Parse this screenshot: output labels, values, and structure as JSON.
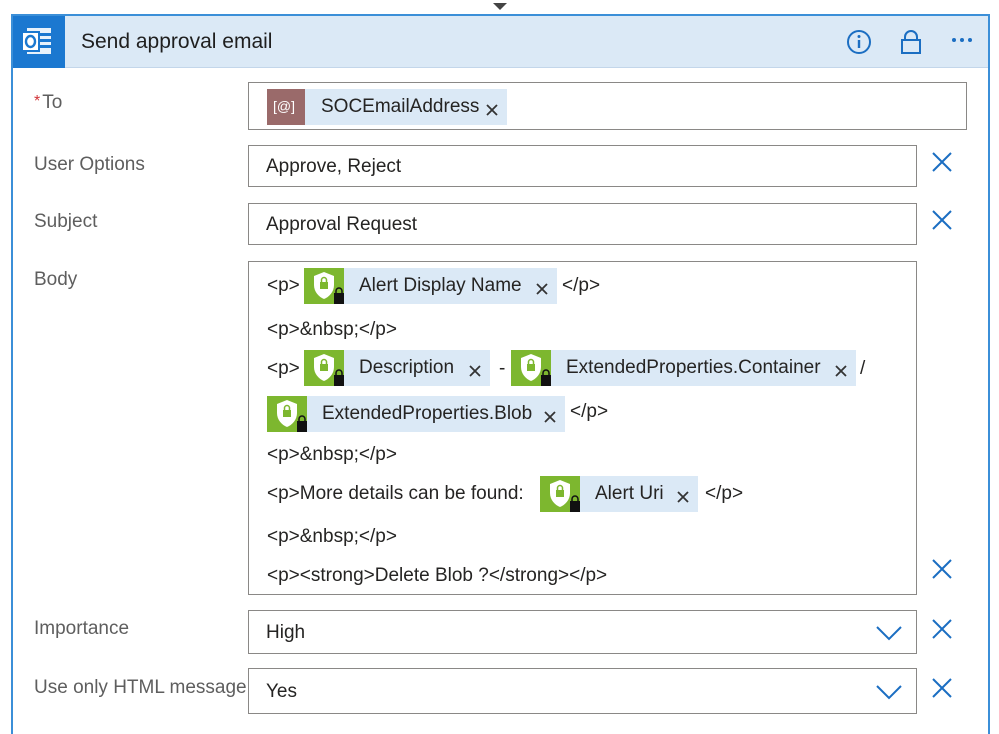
{
  "header": {
    "title": "Send approval email"
  },
  "fields": {
    "to": {
      "label": "To",
      "required_mark": "*",
      "token": "SOCEmailAddress",
      "token_badge": "[@]"
    },
    "user_options": {
      "label": "User Options",
      "value": "Approve, Reject"
    },
    "subject": {
      "label": "Subject",
      "value": "Approval Request"
    },
    "body": {
      "label": "Body",
      "line1_open": "<p>",
      "line1_token": "Alert Display Name",
      "line1_close": "</p>",
      "line2": "<p>&nbsp;</p>",
      "line3_open": "<p>",
      "line3_token1": "Description",
      "line3_dash": "-",
      "line3_token2": "ExtendedProperties.Container",
      "line3_slash": "/",
      "line4_token": "ExtendedProperties.Blob",
      "line4_close": "</p>",
      "line5": "<p>&nbsp;</p>",
      "line6_text": "<p>More details can be found:",
      "line6_token": "Alert Uri",
      "line6_close": "</p>",
      "line7": "<p>&nbsp;</p>",
      "line8": "<p><strong>Delete Blob ?</strong></p>"
    },
    "importance": {
      "label": "Importance",
      "value": "High"
    },
    "html_message": {
      "label": "Use only HTML message",
      "value": "Yes"
    }
  },
  "icons": {
    "app": "outlook-icon",
    "info": "info-icon",
    "lock": "lock-icon",
    "more": "more-icon",
    "token": "security-shield-icon",
    "clear": "close-icon",
    "dropdown": "chevron-down-icon"
  },
  "colors": {
    "header_bg": "#dbe9f6",
    "accent": "#1b78d0",
    "token_bg": "#dbe9f6",
    "shield_green": "#7db72f",
    "required": "#d13438"
  }
}
